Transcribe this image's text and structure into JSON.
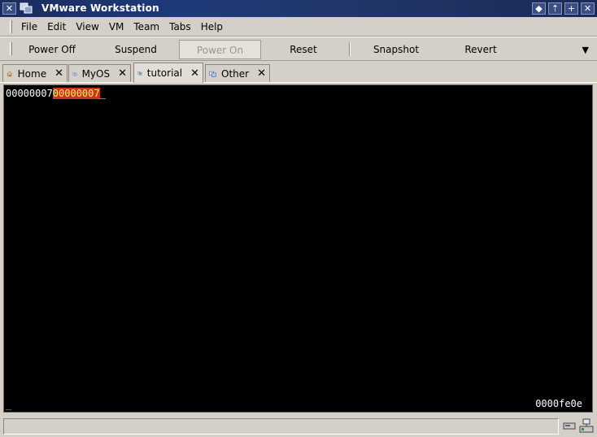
{
  "window": {
    "title": "VMware Workstation",
    "close_glyph": "✕",
    "controls": [
      "◆",
      "⇡",
      "+",
      "✕"
    ]
  },
  "menu": {
    "items": [
      "File",
      "Edit",
      "View",
      "VM",
      "Team",
      "Tabs",
      "Help"
    ]
  },
  "toolbar": {
    "power_off": "Power Off",
    "suspend": "Suspend",
    "power_on": "Power On",
    "reset": "Reset",
    "snapshot": "Snapshot",
    "revert": "Revert",
    "dropdown_glyph": "▼"
  },
  "tabs": [
    {
      "label": "Home",
      "icon": "home-icon",
      "close": "✕"
    },
    {
      "label": "MyOS",
      "icon": "vm-icon",
      "close": "✕"
    },
    {
      "label": "tutorial",
      "icon": "vm-running-icon",
      "close": "✕"
    },
    {
      "label": "Other",
      "icon": "vm-icon",
      "close": "✕"
    }
  ],
  "console": {
    "prefix": "00000007",
    "highlighted": "00000007",
    "cursor": "_",
    "bottom_left": "_",
    "bottom_right": "0000fe0e"
  },
  "colors": {
    "title_bar": "#1e3a7a",
    "chrome": "#d4d0c8",
    "console_bg": "#000000",
    "highlight_bg": "#c8361c",
    "highlight_fg": "#ffe86a"
  }
}
